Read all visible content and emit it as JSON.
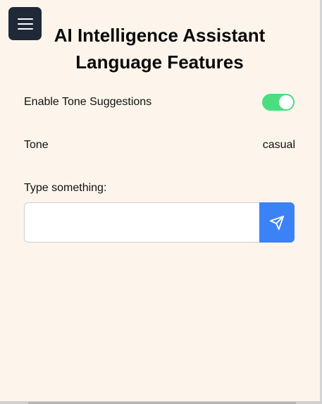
{
  "header": {
    "title": "AI Intelligence Assistant Language Features",
    "menu_icon": "hamburger-menu-icon"
  },
  "settings": {
    "tone_suggestions": {
      "label": "Enable Tone Suggestions",
      "enabled": true
    },
    "tone": {
      "label": "Tone",
      "value": "casual"
    }
  },
  "composer": {
    "label": "Type something:",
    "value": "",
    "placeholder": "",
    "send_icon": "send-icon"
  },
  "colors": {
    "background": "#fdf5ec",
    "menu_button": "#1f2937",
    "toggle_on": "#4ade80",
    "send_button": "#3b82f6"
  }
}
